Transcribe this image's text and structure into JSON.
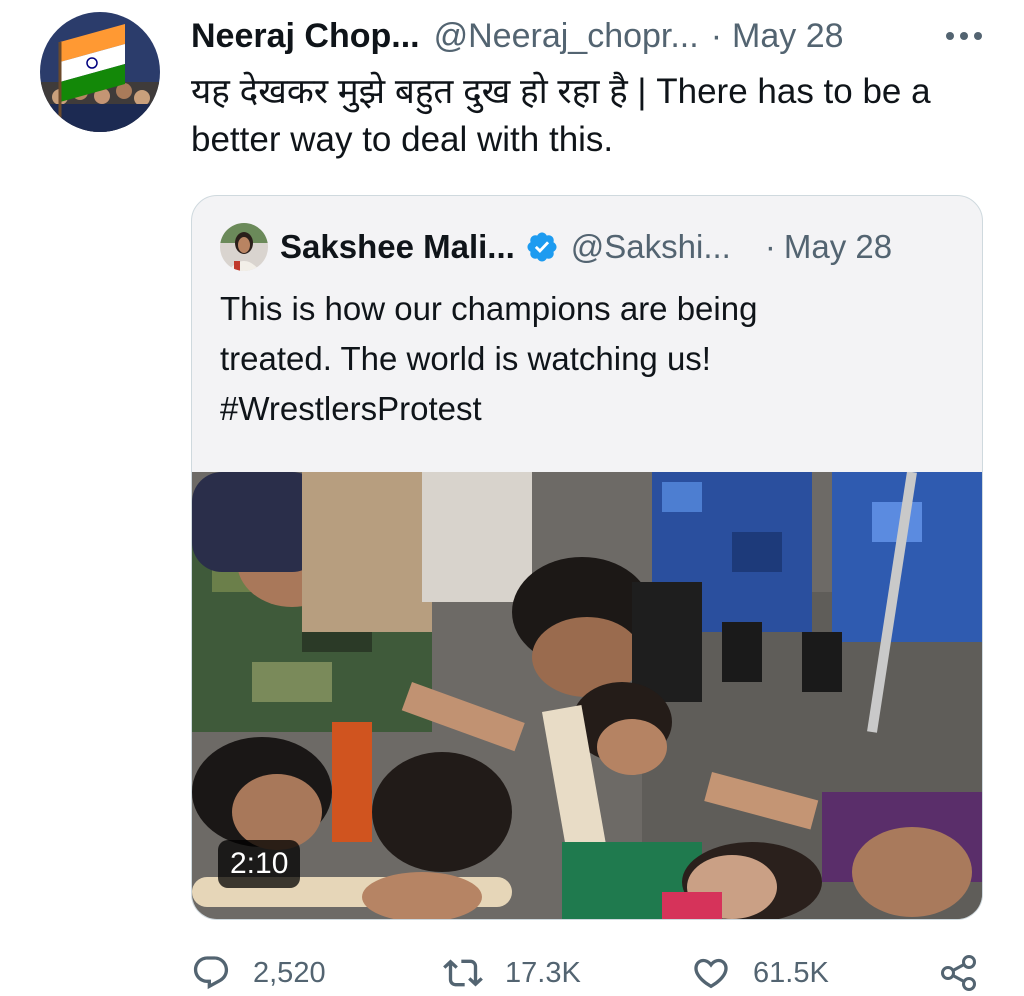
{
  "tweet": {
    "display_name": "Neeraj Chop...",
    "handle": "@Neeraj_chopr...",
    "separator": "·",
    "date": "May 28",
    "text": "यह देखकर मुझे बहुत दुख हो रहा है | There has to be a better way to deal with this."
  },
  "quote": {
    "display_name": "Sakshee Mali...",
    "handle": "@Sakshi...",
    "separator": "·",
    "date": "May 28",
    "verified": true,
    "text_line1": "This is how our champions are being",
    "text_line2": "treated. The world is watching us!",
    "hashtag": "#WrestlersProtest",
    "video_duration": "2:10"
  },
  "actions": {
    "replies": "2,520",
    "retweets": "17.3K",
    "likes": "61.5K"
  },
  "colors": {
    "text_primary": "#0f1419",
    "text_secondary": "#536471",
    "verified_blue": "#1d9bf0",
    "card_border": "#cfd9de"
  },
  "icons": [
    "more-icon",
    "verified-badge-icon",
    "reply-icon",
    "retweet-icon",
    "like-icon",
    "share-icon"
  ]
}
